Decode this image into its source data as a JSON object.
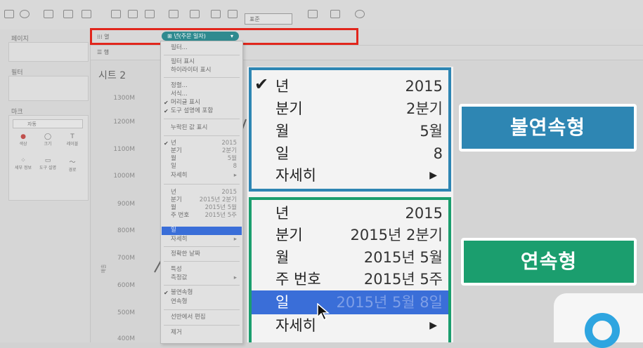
{
  "toolbar": {
    "font_select": "표준"
  },
  "left_panel": {
    "pages_label": "페이지",
    "filters_label": "필터",
    "marks_label": "마크",
    "marks_type": "자동",
    "mark_buttons": [
      "색상",
      "크기",
      "레이블",
      "세부 정보",
      "도구 설명",
      "경로"
    ]
  },
  "shelves": {
    "columns_label": "열",
    "rows_label": "행",
    "pill_label": "년(주문 일자)"
  },
  "sheet": {
    "title": "시트 2"
  },
  "y_axis": {
    "ticks": [
      "1300M",
      "1200M",
      "1100M",
      "1000M",
      "900M",
      "800M",
      "700M",
      "600M",
      "500M",
      "400M"
    ],
    "label": "매출"
  },
  "small_menu": {
    "filter": "필터...",
    "show_filter": "필터 표시",
    "show_highlighter": "하이라이터 표시",
    "sort": "정렬...",
    "format": "서식...",
    "show_header": "머리글 표시",
    "include_tooltip": "도구 설명에 포함",
    "show_missing": "누락된 값 표시",
    "discrete": [
      {
        "label": "년",
        "value": "2015"
      },
      {
        "label": "분기",
        "value": "2분기"
      },
      {
        "label": "월",
        "value": "5월"
      },
      {
        "label": "일",
        "value": "8"
      }
    ],
    "more": "자세히",
    "continuous": [
      {
        "label": "년",
        "value": "2015"
      },
      {
        "label": "분기",
        "value": "2015년 2분기"
      },
      {
        "label": "월",
        "value": "2015년 5월"
      },
      {
        "label": "주 번호",
        "value": "2015년 5주"
      },
      {
        "label": "일",
        "value": ""
      }
    ],
    "more2": "자세히",
    "exact_date": "정확한 날짜",
    "attribute": "특성",
    "measure": "측정값",
    "discontinuous": "불연속형",
    "continuous_opt": "연속형",
    "edit_shelf": "선반에서 편집",
    "remove": "제거"
  },
  "zoom_menu": {
    "discrete": [
      {
        "label": "년",
        "value": "2015"
      },
      {
        "label": "분기",
        "value": "2분기"
      },
      {
        "label": "월",
        "value": "5월"
      },
      {
        "label": "일",
        "value": "8"
      }
    ],
    "more": "자세히",
    "continuous": [
      {
        "label": "년",
        "value": "2015"
      },
      {
        "label": "분기",
        "value": "2015년 2분기"
      },
      {
        "label": "월",
        "value": "2015년 5월"
      },
      {
        "label": "주 번호",
        "value": "2015년 5주"
      },
      {
        "label": "일",
        "value": "2015년 5월 8일"
      }
    ],
    "more2": "자세히"
  },
  "badges": {
    "discrete": "불연속형",
    "continuous": "연속형"
  },
  "colors": {
    "discrete_accent": "#2e86b3",
    "continuous_accent": "#1b9e6e",
    "highlight": "#e1261c",
    "selection": "#3a6ed8",
    "pill": "#2f8a8f"
  }
}
